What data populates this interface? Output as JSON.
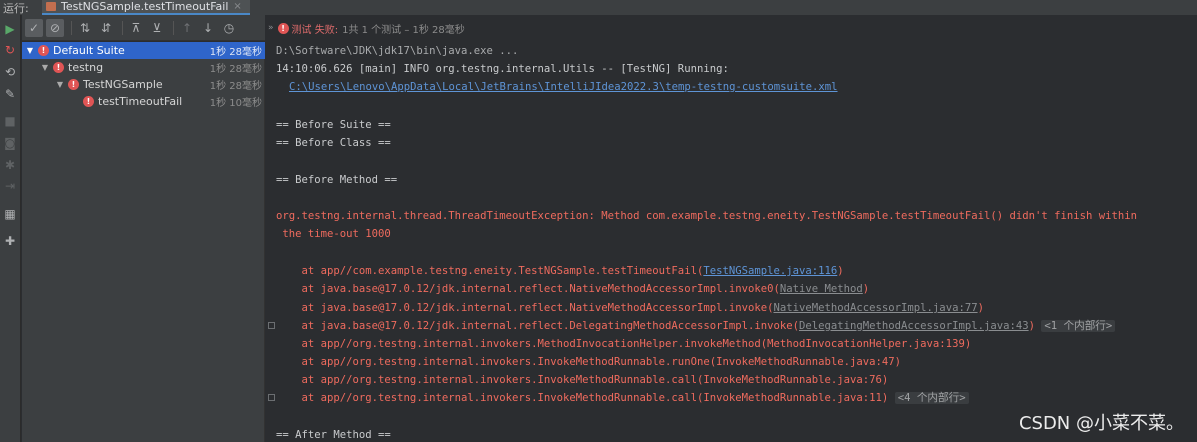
{
  "topbar": {
    "run_label": "运行:",
    "tab_title": "TestNGSample.testTimeoutFail",
    "tab_close": "×"
  },
  "left_toolbar": {
    "icons": [
      "rerun-icon",
      "rerun-failed-icon",
      "toggle-autotest-icon",
      "settings-wrench-icon",
      "stop-icon",
      "camera-icon",
      "debug-bug-icon",
      "exit-icon",
      "layout-icon",
      "pin-icon"
    ]
  },
  "tree_toolbar": {
    "buttons": [
      "show-passed-icon",
      "show-ignored-icon",
      "sort-alpha-icon",
      "sort-duration-icon",
      "expand-all-icon",
      "collapse-all-icon",
      "prev-failed-icon",
      "next-failed-icon",
      "history-icon"
    ]
  },
  "tree": {
    "items": [
      {
        "label": "Default Suite",
        "time": "1秒 28毫秒"
      },
      {
        "label": "testng",
        "time": "1秒 28毫秒"
      },
      {
        "label": "TestNGSample",
        "time": "1秒 28毫秒"
      },
      {
        "label": "testTimeoutFail",
        "time": "1秒 10毫秒"
      }
    ]
  },
  "status": {
    "fail_text": "测试 失败:",
    "detail": "1共 1 个测试 – 1秒 28毫秒"
  },
  "console": {
    "line_java": "D:\\Software\\JDK\\jdk17\\bin\\java.exe ...",
    "line_running": "14:10:06.626 [main] INFO org.testng.internal.Utils -- [TestNG] Running:",
    "line_xml": "C:\\Users\\Lenovo\\AppData\\Local\\JetBrains\\IntelliJIdea2022.3\\temp-testng-customsuite.xml",
    "before_suite": "== Before Suite ==",
    "before_class": "== Before Class ==",
    "before_method": "== Before Method ==",
    "exception_1": "org.testng.internal.thread.ThreadTimeoutException: Method com.example.testng.eneity.TestNGSample.testTimeoutFail() didn't finish within",
    "exception_2": " the time-out 1000",
    "stack": [
      {
        "pre": "    at app//com.example.testng.eneity.TestNGSample.testTimeoutFail(",
        "link": "TestNGSample.java:116",
        "post": ")",
        "link_style": "blue",
        "folded": ""
      },
      {
        "pre": "    at java.base@17.0.12/jdk.internal.reflect.NativeMethodAccessorImpl.invoke0(",
        "link": "Native Method",
        "post": ")",
        "link_style": "gray",
        "folded": ""
      },
      {
        "pre": "    at java.base@17.0.12/jdk.internal.reflect.NativeMethodAccessorImpl.invoke(",
        "link": "NativeMethodAccessorImpl.java:77",
        "post": ")",
        "link_style": "gray",
        "folded": ""
      },
      {
        "pre": "    at java.base@17.0.12/jdk.internal.reflect.DelegatingMethodAccessorImpl.invoke(",
        "link": "DelegatingMethodAccessorImpl.java:43",
        "post": ")",
        "link_style": "gray",
        "folded": "<1 个内部行>"
      },
      {
        "pre": "    at app//org.testng.internal.invokers.MethodInvocationHelper.invokeMethod(MethodInvocationHelper.java:139)",
        "link": "",
        "post": "",
        "link_style": "",
        "folded": ""
      },
      {
        "pre": "    at app//org.testng.internal.invokers.InvokeMethodRunnable.runOne(InvokeMethodRunnable.java:47)",
        "link": "",
        "post": "",
        "link_style": "",
        "folded": ""
      },
      {
        "pre": "    at app//org.testng.internal.invokers.InvokeMethodRunnable.call(InvokeMethodRunnable.java:76)",
        "link": "",
        "post": "",
        "link_style": "",
        "folded": ""
      },
      {
        "pre": "    at app//org.testng.internal.invokers.InvokeMethodRunnable.call(InvokeMethodRunnable.java:11)",
        "link": "",
        "post": "",
        "link_style": "",
        "folded": "<4 个内部行>"
      }
    ],
    "after_method": "== After Method =="
  },
  "watermark": "CSDN @小菜不菜。",
  "colors": {
    "error": "#e05555",
    "selection": "#2f65ca",
    "exception_text": "#ef6b5e",
    "link": "#5e94d6"
  }
}
